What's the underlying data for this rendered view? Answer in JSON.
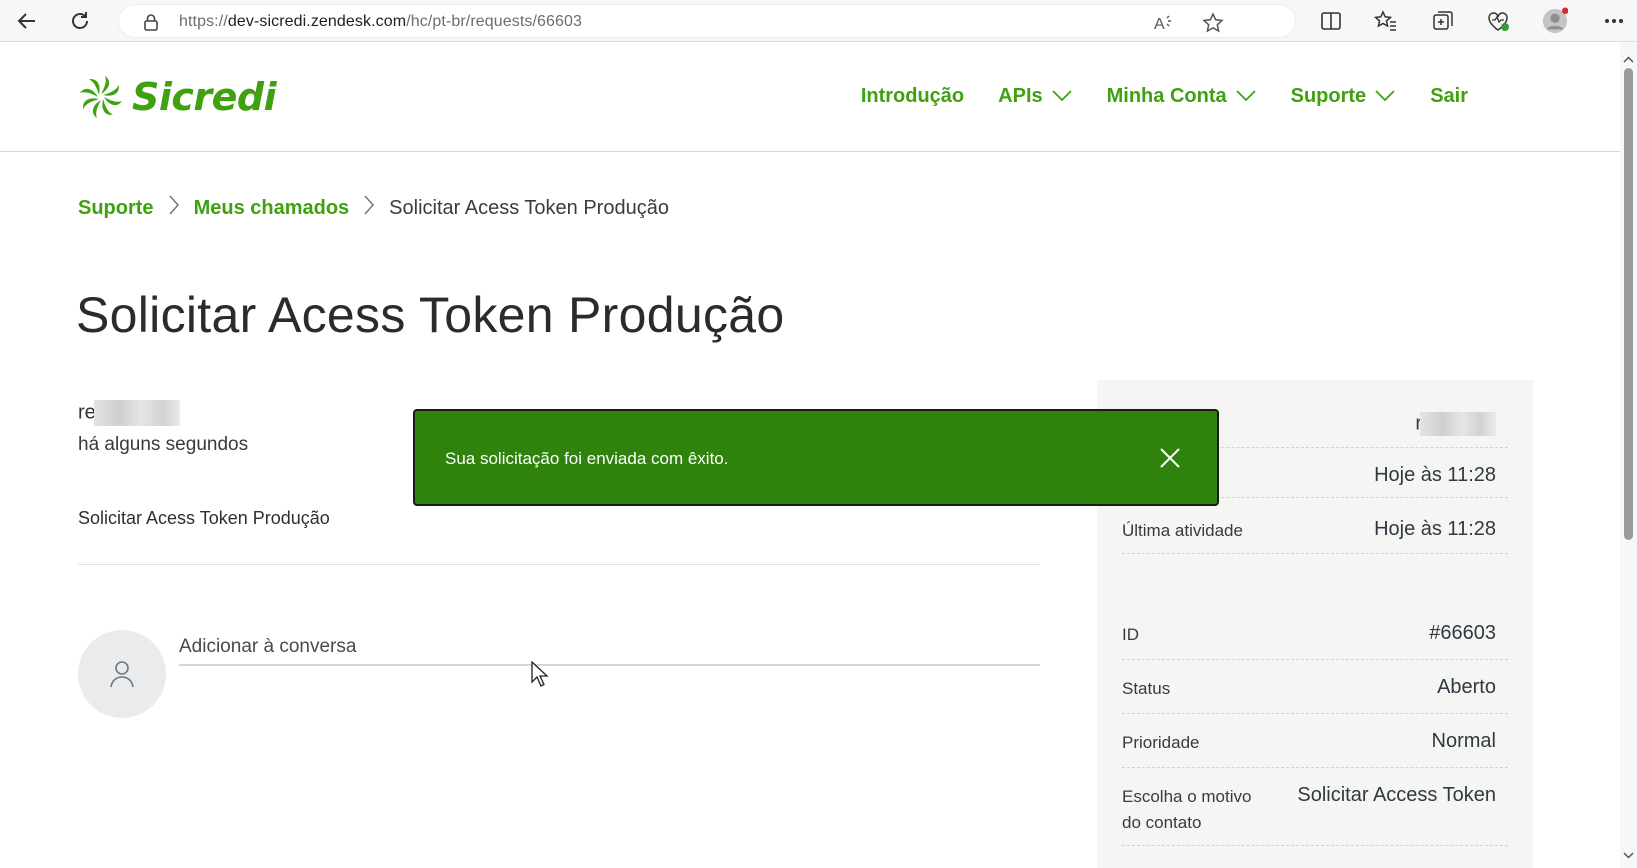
{
  "browser": {
    "url_prefix": "https://",
    "url_host": "dev-sicredi.zendesk.com",
    "url_path": "/hc/pt-br/requests/66603"
  },
  "header": {
    "logo_text": "Sicredi",
    "nav": [
      {
        "label": "Introdução",
        "has_dropdown": false
      },
      {
        "label": "APIs",
        "has_dropdown": true
      },
      {
        "label": "Minha Conta",
        "has_dropdown": true
      },
      {
        "label": "Suporte",
        "has_dropdown": true
      },
      {
        "label": "Sair",
        "has_dropdown": false
      }
    ]
  },
  "breadcrumb": {
    "items": [
      "Suporte",
      "Meus chamados"
    ],
    "current": "Solicitar Acess Token Produção"
  },
  "request": {
    "title": "Solicitar Acess Token Produção",
    "author_prefix": "re",
    "time_ago": "há alguns segundos",
    "description": "Solicitar Acess Token Produção",
    "comment_placeholder": "Adicionar à conversa"
  },
  "toast": {
    "message": "Sua solicitação foi enviada com êxito."
  },
  "details": {
    "requester_prefix": "r",
    "created": "Hoje às 11:28",
    "last_activity_label": "Última atividade",
    "last_activity": "Hoje às 11:28",
    "id_label": "ID",
    "id": "#66603",
    "status_label": "Status",
    "status": "Aberto",
    "priority_label": "Prioridade",
    "priority": "Normal",
    "reason_label_1": "Escolha o motivo",
    "reason_label_2": "do contato",
    "reason": "Solicitar Access Token"
  },
  "colors": {
    "brand_green": "#3fa110",
    "toast_green": "#2f830c",
    "sidebar_bg": "#f5f6f4"
  }
}
